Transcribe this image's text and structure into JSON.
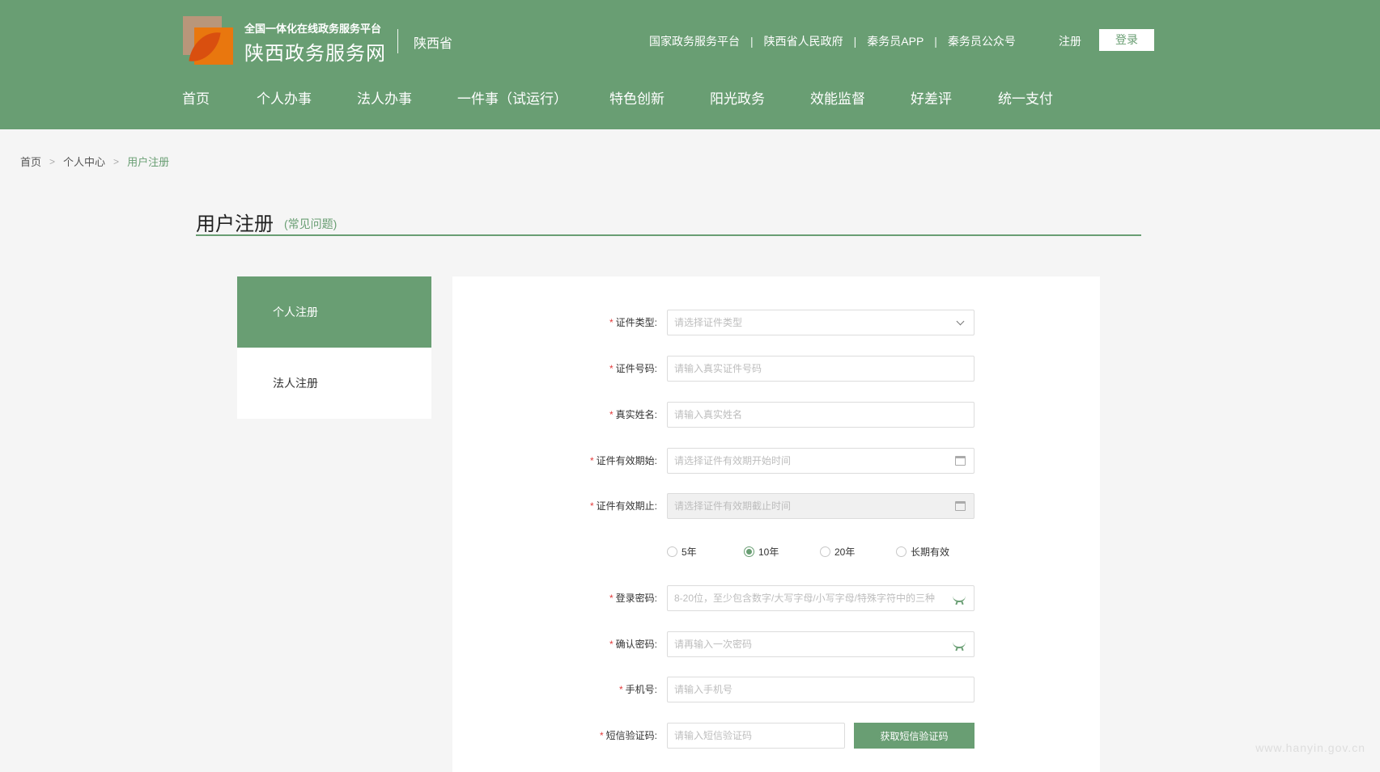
{
  "header": {
    "subtitle": "全国一体化在线政务服务平台",
    "title": "陕西政务服务网",
    "region": "陕西省",
    "top_links": [
      "国家政务服务平台",
      "陕西省人民政府",
      "秦务员APP",
      "秦务员公众号"
    ],
    "separator": "|",
    "register_label": "注册",
    "login_label": "登录",
    "nav": [
      "首页",
      "个人办事",
      "法人办事",
      "一件事（试运行）",
      "特色创新",
      "阳光政务",
      "效能监督",
      "好差评",
      "统一支付"
    ]
  },
  "breadcrumb": {
    "items": [
      "首页",
      "个人中心",
      "用户注册"
    ],
    "separator": ">"
  },
  "page": {
    "title": "用户注册",
    "faq_label": "(常见问题)"
  },
  "side_tabs": {
    "personal": "个人注册",
    "legal": "法人注册",
    "active": "个人注册"
  },
  "form": {
    "required_mark": "*",
    "cert_type": {
      "label": "证件类型:",
      "placeholder": "请选择证件类型"
    },
    "cert_number": {
      "label": "证件号码:",
      "placeholder": "请输入真实证件号码"
    },
    "real_name": {
      "label": "真实姓名:",
      "placeholder": "请输入真实姓名"
    },
    "valid_start": {
      "label": "证件有效期始:",
      "placeholder": "请选择证件有效期开始时间"
    },
    "valid_end": {
      "label": "证件有效期止:",
      "placeholder": "请选择证件有效期截止时间"
    },
    "validity_options": [
      "5年",
      "10年",
      "20年",
      "长期有效"
    ],
    "validity_selected": "10年",
    "password": {
      "label": "登录密码:",
      "placeholder": "8-20位，至少包含数字/大写字母/小写字母/特殊字符中的三种"
    },
    "confirm_password": {
      "label": "确认密码:",
      "placeholder": "请再输入一次密码"
    },
    "phone": {
      "label": "手机号:",
      "placeholder": "请输入手机号"
    },
    "sms_code": {
      "label": "短信验证码:",
      "placeholder": "请输入短信验证码",
      "button": "获取短信验证码"
    }
  },
  "watermark": "www.hanyin.gov.cn",
  "colors": {
    "primary": "#699e73",
    "required": "#e23b3b",
    "logo_orange": "#e9770e",
    "logo_tan": "#b9967a"
  }
}
